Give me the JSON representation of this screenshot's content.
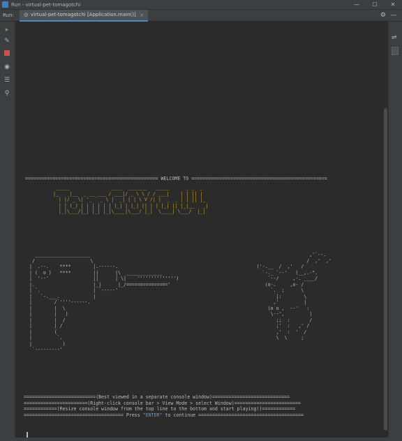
{
  "window": {
    "title": "Run - virtual-pet-tomagotchi",
    "controls": {
      "minimize": "—",
      "maximize": "☐",
      "close": "✕"
    }
  },
  "run_panel": {
    "label": "Run:",
    "tab_label": "virtual-pet-tomagotchi [Application.main()]",
    "tab_close": "×"
  },
  "console": {
    "welcome_line": "================================================ WELCOME TO =================================================",
    "logo": "  _____               ____  _______   _____      _ _  _\n |_   _|__  _ __ ___ / ___|/ _ \\ \\ / / ___|    | | || |\n   | |/ _ \\| '_ ` _ \\ |  _| | | \\ V /| |  _  _ | | || |_\n   | | (_) | | | | | | |_| | |_| || | | |_| || |_|__   _|\n   |_|\\___/|_| |_| |_|\\____|\\___/ |_|  \\____| \\___/  |_|",
    "art_left": "  ____________________\n /                    \\\n|  .--.    ****        |.------.\n| (  o )   ****        ||      |\\  _____________\n|  '--'                ||      | \\|    '''''''''''''')\n|.                     |_|      |_/==============='\n| `.                   | `-----'\n|   `-.___.            |\n|        /`''''------.\n|        |  \\\n|        |   )\n|        |  /\n|        | /\n|        (\n|         `.\n|           )\n `---------'",
    "art_right": "                          ,'`--.\n                         /  ,'  ,'\n       ('-.__  /  ,'   /\n         `-._ `--'   (__,.-\".\n           `--/     ,-. ____/\n          (o-.     ,o- /\n            `.  ;      \\\n              |:        \\\n             ,'         |\n           (o o ,  --'   :\n            \\--',         |\n              ;;  :       /\n              ;'  :   ,' /\n              ,'  :  '  /\n              \\  \\     ;",
    "footer": {
      "line1": "==========================(Best viewed in a separate console window)============================",
      "line2": "=======================(Right-click console bar > View Mode > select Window)========================",
      "line3": "============(Resize console window from the top line to the bottom and start playing!)============",
      "line4_pre": "==================================== Press ",
      "line4_key": "\"ENTER\"",
      "line4_post": " to continue ======================================"
    }
  },
  "colors": {
    "logo": "#c7a41a",
    "enter_key": "#5f9bd4",
    "background": "#2b2b2b"
  },
  "icons": [
    "app-icon",
    "rerun-icon",
    "wrench-icon",
    "stop-icon",
    "camera-icon",
    "layout-icon",
    "pin-icon",
    "gear-icon",
    "minimize-panel-icon",
    "soft-wrap-icon",
    "scroll-to-end-icon"
  ]
}
